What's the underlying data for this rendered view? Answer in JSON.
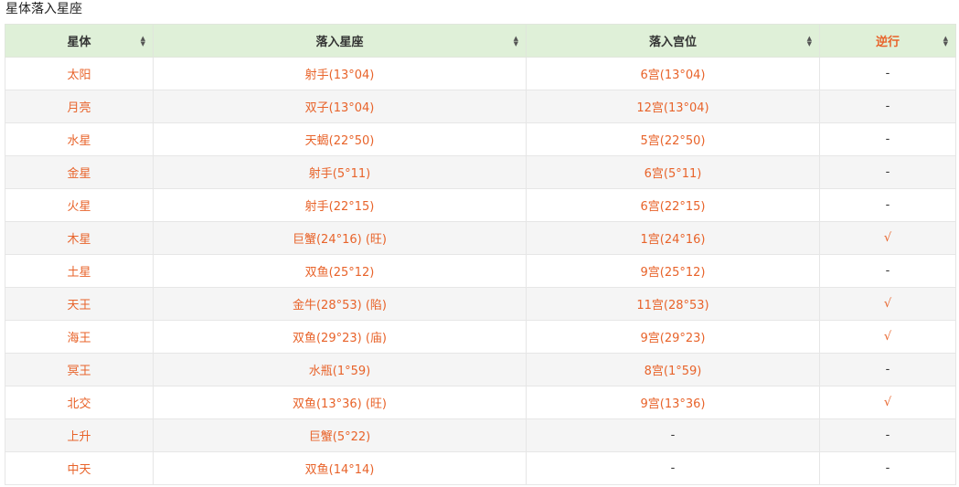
{
  "title": "星体落入星座",
  "columns": [
    "星体",
    "落入星座",
    "落入宫位",
    "逆行"
  ],
  "accent_color": "#e8632a",
  "header_bg": "#dff0d8",
  "rows": [
    {
      "planet": "太阳",
      "sign": "射手(13°04)",
      "house": "6宫(13°04)",
      "retro": "-"
    },
    {
      "planet": "月亮",
      "sign": "双子(13°04)",
      "house": "12宫(13°04)",
      "retro": "-"
    },
    {
      "planet": "水星",
      "sign": "天蝎(22°50)",
      "house": "5宫(22°50)",
      "retro": "-"
    },
    {
      "planet": "金星",
      "sign": "射手(5°11)",
      "house": "6宫(5°11)",
      "retro": "-"
    },
    {
      "planet": "火星",
      "sign": "射手(22°15)",
      "house": "6宫(22°15)",
      "retro": "-"
    },
    {
      "planet": "木星",
      "sign": "巨蟹(24°16) (旺)",
      "house": "1宫(24°16)",
      "retro": "√"
    },
    {
      "planet": "土星",
      "sign": "双鱼(25°12)",
      "house": "9宫(25°12)",
      "retro": "-"
    },
    {
      "planet": "天王",
      "sign": "金牛(28°53) (陷)",
      "house": "11宫(28°53)",
      "retro": "√"
    },
    {
      "planet": "海王",
      "sign": "双鱼(29°23) (庙)",
      "house": "9宫(29°23)",
      "retro": "√"
    },
    {
      "planet": "冥王",
      "sign": "水瓶(1°59)",
      "house": "8宫(1°59)",
      "retro": "-"
    },
    {
      "planet": "北交",
      "sign": "双鱼(13°36) (旺)",
      "house": "9宫(13°36)",
      "retro": "√"
    },
    {
      "planet": "上升",
      "sign": "巨蟹(5°22)",
      "house": "-",
      "retro": "-"
    },
    {
      "planet": "中天",
      "sign": "双鱼(14°14)",
      "house": "-",
      "retro": "-"
    }
  ]
}
